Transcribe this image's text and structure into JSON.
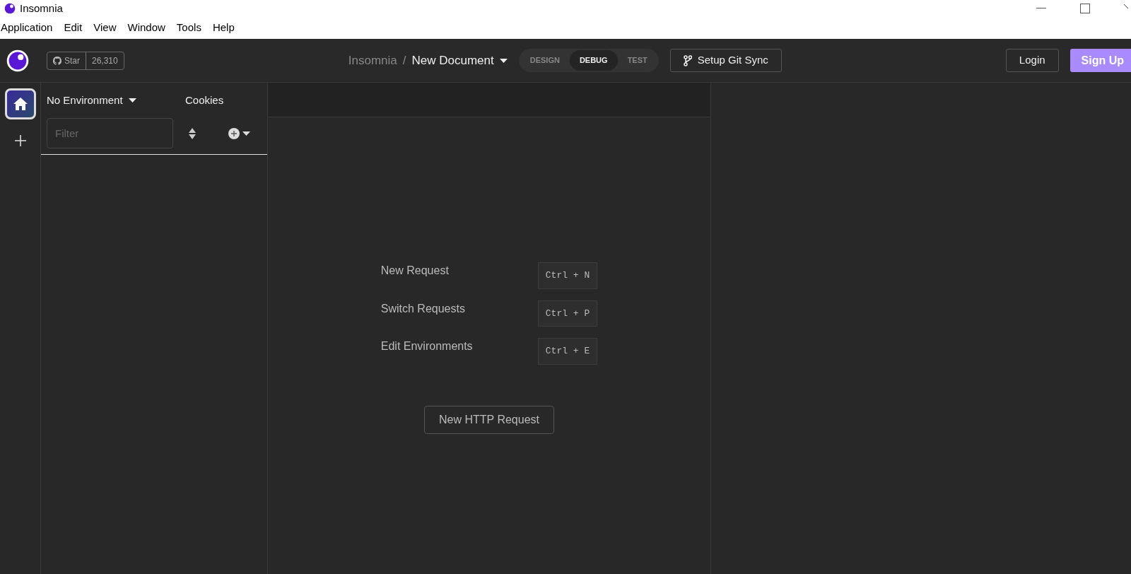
{
  "window": {
    "title": "Insomnia"
  },
  "menu": [
    "Application",
    "Edit",
    "View",
    "Window",
    "Tools",
    "Help"
  ],
  "header": {
    "star_label": "Star",
    "star_count": "26,310",
    "breadcrumb_root": "Insomnia",
    "separator": "/",
    "document": "New Document",
    "modes": [
      {
        "label": "DESIGN",
        "selected": false
      },
      {
        "label": "DEBUG",
        "selected": true
      },
      {
        "label": "TEST",
        "selected": false
      }
    ],
    "git_sync": "Setup Git Sync",
    "login": "Login",
    "signup": "Sign Up"
  },
  "rail": [
    {
      "kind": "home",
      "selected": true
    },
    {
      "kind": "add",
      "selected": false
    }
  ],
  "sidebar": {
    "environment": "No Environment",
    "cookies": "Cookies",
    "filter": {
      "placeholder": "Filter"
    }
  },
  "shortcuts": [
    {
      "label": "New Request",
      "keys": "Ctrl + N"
    },
    {
      "label": "Switch Requests",
      "keys": "Ctrl + P"
    },
    {
      "label": "Edit Environments",
      "keys": "Ctrl + E"
    }
  ],
  "new_request_button": "New HTTP Request"
}
